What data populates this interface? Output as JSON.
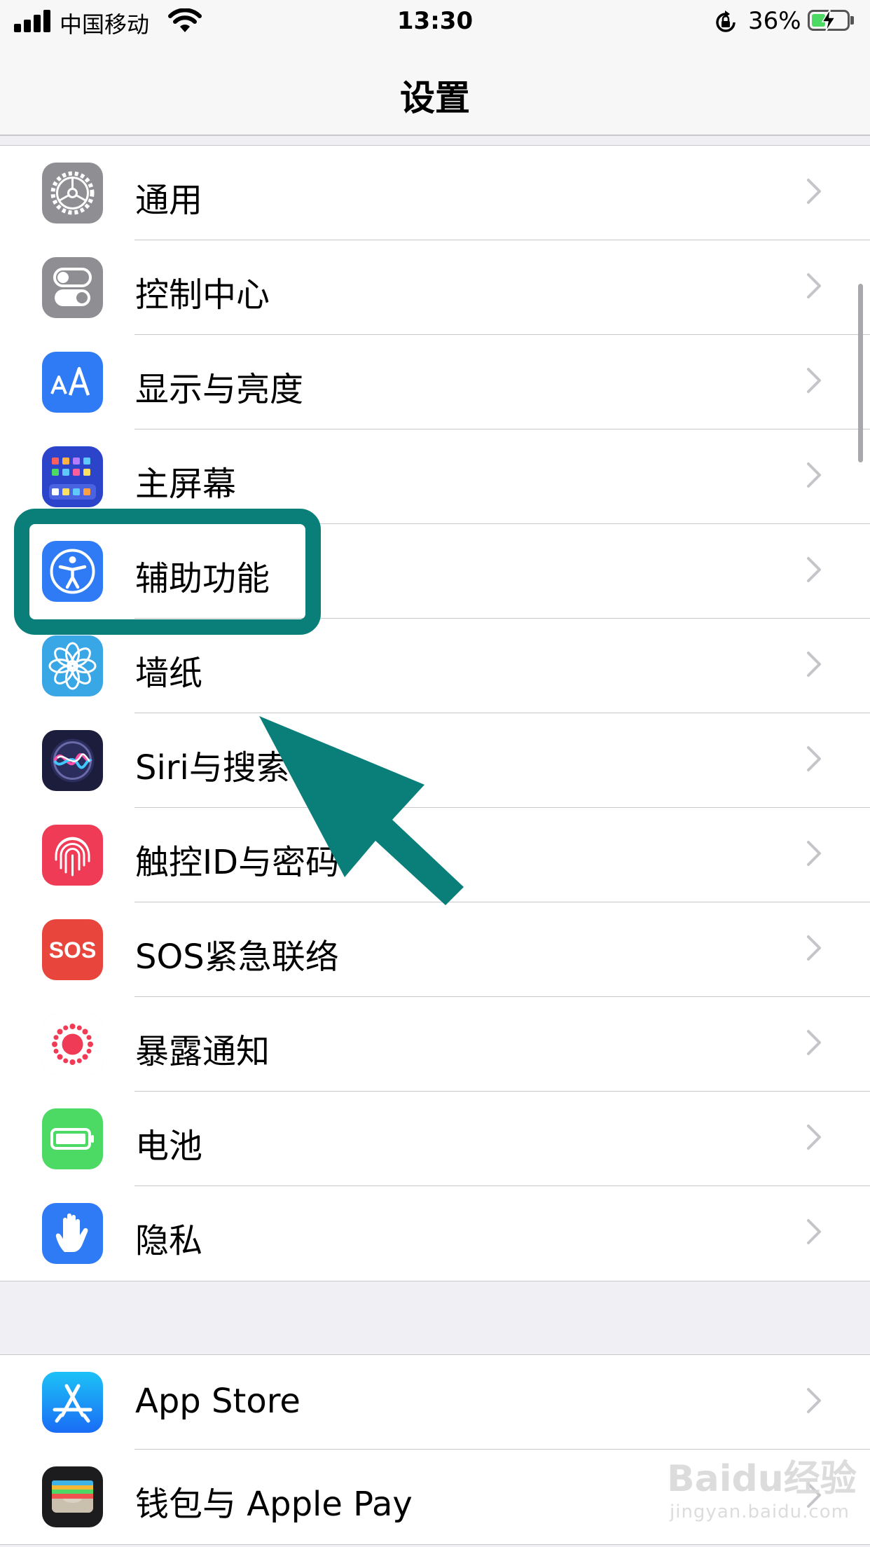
{
  "status_bar": {
    "carrier": "中国移动",
    "time": "13:30",
    "battery_percent": "36%",
    "battery_level": 0.36
  },
  "nav": {
    "title": "设置"
  },
  "group1": [
    {
      "label": "通用",
      "icon": "gear-icon",
      "color": "#8e8e93"
    },
    {
      "label": "控制中心",
      "icon": "toggle-switches-icon",
      "color": "#8e8e93"
    },
    {
      "label": "显示与亮度",
      "icon": "text-size-icon",
      "color": "#2f7bf5"
    },
    {
      "label": "主屏幕",
      "icon": "home-grid-icon",
      "color": "#2c44c9"
    },
    {
      "label": "辅助功能",
      "icon": "accessibility-icon",
      "color": "#2f7bf5"
    },
    {
      "label": "墙纸",
      "icon": "flower-icon",
      "color": "#39a6e6"
    },
    {
      "label": "Siri与搜索",
      "icon": "siri-icon",
      "color": "#1c1c3c"
    },
    {
      "label": "触控ID与密码",
      "icon": "fingerprint-icon",
      "color": "#ef3b55"
    },
    {
      "label": "SOS紧急联络",
      "icon": "sos-icon",
      "color": "#e8453c"
    },
    {
      "label": "暴露通知",
      "icon": "exposure-icon",
      "color": "#ffffff"
    },
    {
      "label": "电池",
      "icon": "battery-icon",
      "color": "#4cd964"
    },
    {
      "label": "隐私",
      "icon": "hand-icon",
      "color": "#2f7bf5"
    }
  ],
  "group2": [
    {
      "label": "App Store",
      "icon": "app-store-icon",
      "color": "#1a8cf5"
    },
    {
      "label": "钱包与 Apple Pay",
      "icon": "wallet-icon",
      "color": "#1c1c1e"
    }
  ],
  "sos_text": "SOS",
  "annotation": {
    "color": "#0a7f79"
  },
  "watermark": {
    "brand": "Baidu经验",
    "url": "jingyan.baidu.com"
  }
}
